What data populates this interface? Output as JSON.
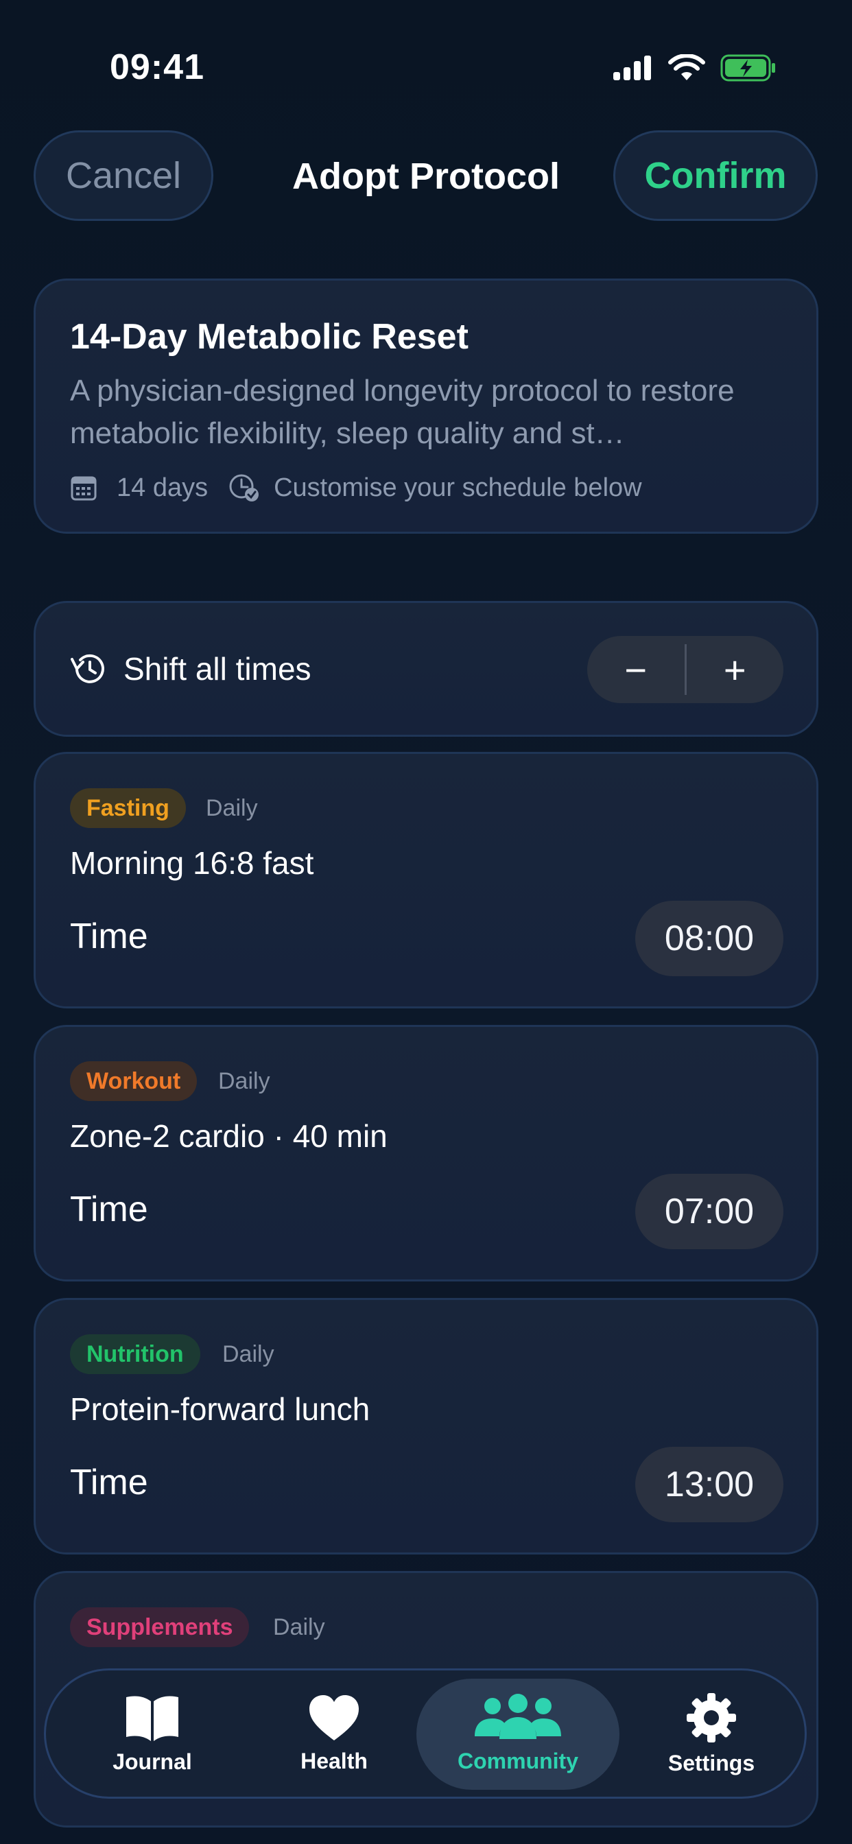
{
  "status": {
    "time": "09:41"
  },
  "nav": {
    "cancel_label": "Cancel",
    "title": "Adopt Protocol",
    "confirm_label": "Confirm"
  },
  "protocol": {
    "title": "14-Day Metabolic Reset",
    "description": "A physician-designed longevity protocol to restore metabolic flexibility, sleep quality and st…",
    "duration": "14 days",
    "hint": "Customise your schedule below"
  },
  "shift": {
    "label": "Shift all times",
    "minus": "−",
    "plus": "+"
  },
  "items": [
    {
      "category": "Fasting",
      "frequency": "Daily",
      "title": "Morning 16:8 fast",
      "time_label": "Time",
      "time": "08:00"
    },
    {
      "category": "Workout",
      "frequency": "Daily",
      "title": "Zone-2 cardio · 40 min",
      "time_label": "Time",
      "time": "07:00"
    },
    {
      "category": "Nutrition",
      "frequency": "Daily",
      "title": "Protein-forward lunch",
      "time_label": "Time",
      "time": "13:00"
    },
    {
      "category": "Supplements",
      "frequency": "Daily"
    }
  ],
  "tabs": [
    {
      "label": "Journal",
      "icon": "book-icon"
    },
    {
      "label": "Health",
      "icon": "heart-icon"
    },
    {
      "label": "Community",
      "icon": "people-icon",
      "active": true
    },
    {
      "label": "Settings",
      "icon": "gear-icon"
    }
  ],
  "colors": {
    "accent": "#2fd18a",
    "fasting": "#f0a020",
    "workout": "#f07a2a",
    "nutrition": "#22c36a",
    "supplements": "#e0407a",
    "active_tab": "#2ed3b0"
  }
}
